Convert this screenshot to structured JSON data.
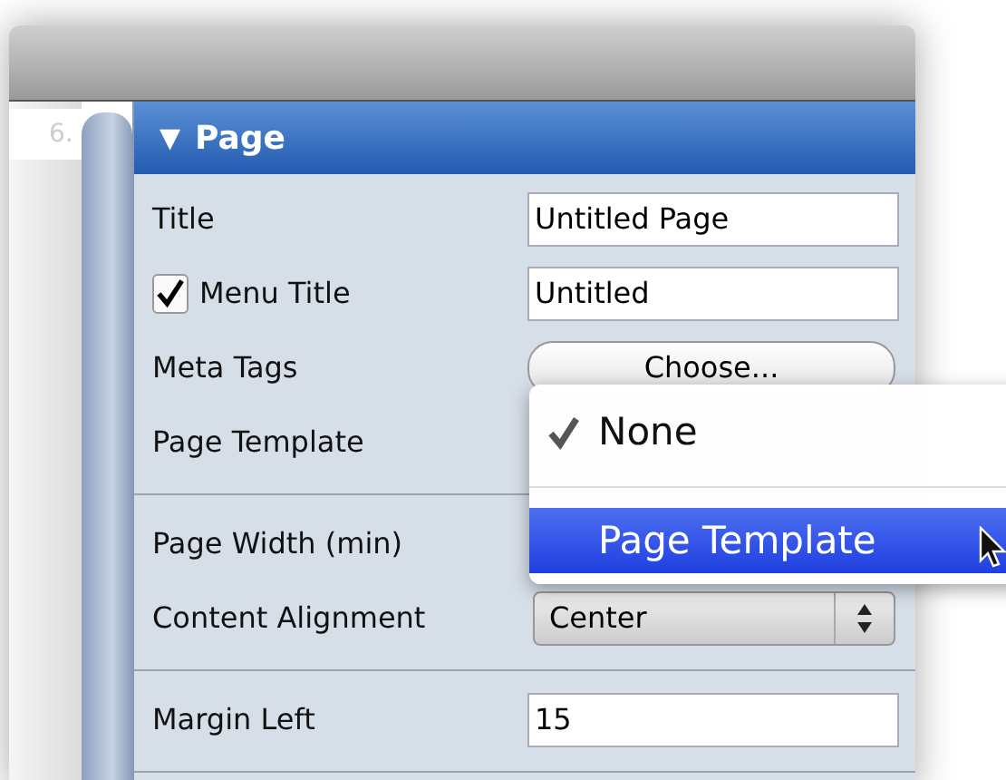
{
  "sidebar": {
    "item": "6."
  },
  "panel": {
    "disclosure": "▼",
    "title": "Page",
    "sections": [
      {
        "rows": [
          {
            "kind": "text",
            "label": "Title",
            "value": "Untitled Page"
          },
          {
            "kind": "checkbox-text",
            "label": "Menu Title",
            "checked": true,
            "value": "Untitled"
          },
          {
            "kind": "button",
            "label": "Meta Tags",
            "button": "Choose..."
          },
          {
            "kind": "covered",
            "label": "Page Template"
          }
        ]
      },
      {
        "rows": [
          {
            "kind": "covered",
            "label": "Page Width (min)"
          },
          {
            "kind": "select",
            "label": "Content Alignment",
            "value": "Center"
          }
        ]
      },
      {
        "rows": [
          {
            "kind": "text",
            "label": "Margin Left",
            "value": "15"
          }
        ]
      }
    ]
  },
  "menu": {
    "items": [
      {
        "kind": "item",
        "label": "None",
        "checked": true,
        "selected": false
      },
      {
        "kind": "separator"
      },
      {
        "kind": "item",
        "label": "Page Template",
        "checked": false,
        "selected": true
      }
    ]
  }
}
